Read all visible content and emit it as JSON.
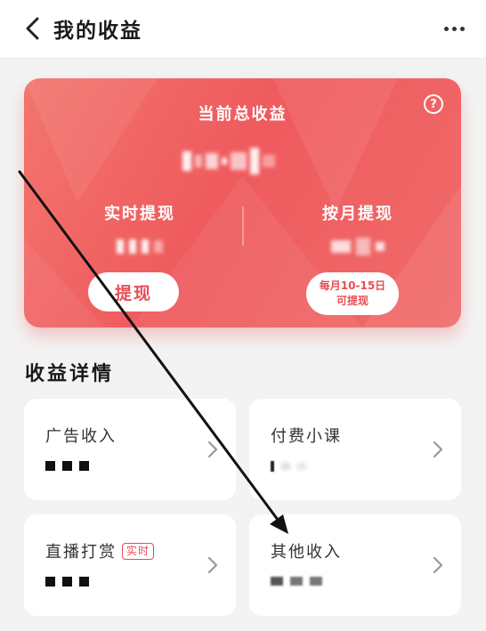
{
  "header": {
    "title": "我的收益"
  },
  "card": {
    "total_label": "当前总收益",
    "realtime_label": "实时提现",
    "monthly_label": "按月提现",
    "withdraw_button": "提现",
    "monthly_note_line1": "每月10-15日",
    "monthly_note_line2": "可提现",
    "help_symbol": "?"
  },
  "details": {
    "section_title": "收益详情",
    "tiles": [
      {
        "title": "广告收入"
      },
      {
        "title": "付费小课"
      },
      {
        "title": "直播打赏",
        "badge": "实时"
      },
      {
        "title": "其他收入"
      }
    ]
  },
  "colors": {
    "card_gradient_start": "#f3756e",
    "card_gradient_end": "#ef5b5e",
    "accent": "#e94d55"
  }
}
